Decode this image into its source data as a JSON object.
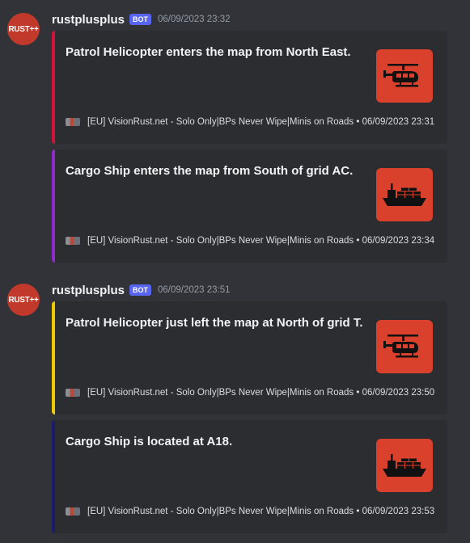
{
  "messages": [
    {
      "avatar_text": "RUST++",
      "username": "rustplusplus",
      "badge": "BOT",
      "timestamp": "06/09/2023 23:32",
      "embeds": [
        {
          "title": "Patrol Helicopter enters the map from North East.",
          "icon": "helicopter-icon",
          "accent": "#d1133a",
          "footer": "[EU] VisionRust.net - Solo Only|BPs Never Wipe|Minis on Roads • 06/09/2023 23:31"
        },
        {
          "title": "Cargo Ship enters the map from South of grid AC.",
          "icon": "cargo-ship-icon",
          "accent": "#8e2cc9",
          "footer": "[EU] VisionRust.net - Solo Only|BPs Never Wipe|Minis on Roads • 06/09/2023 23:34"
        }
      ]
    },
    {
      "avatar_text": "RUST++",
      "username": "rustplusplus",
      "badge": "BOT",
      "timestamp": "06/09/2023 23:51",
      "embeds": [
        {
          "title": "Patrol Helicopter just left the map at North of grid T.",
          "icon": "helicopter-icon",
          "accent": "#f0c800",
          "footer": "[EU] VisionRust.net - Solo Only|BPs Never Wipe|Minis on Roads • 06/09/2023 23:50"
        },
        {
          "title": "Cargo Ship is located at A18.",
          "icon": "cargo-ship-icon",
          "accent": "#1c1a6b",
          "footer": "[EU] VisionRust.net - Solo Only|BPs Never Wipe|Minis on Roads • 06/09/2023 23:53"
        }
      ]
    }
  ],
  "colors": {
    "background": "#313338",
    "embed_background": "#2b2d31",
    "thumbnail": "#d9412c",
    "bot_badge": "#5865f2"
  }
}
